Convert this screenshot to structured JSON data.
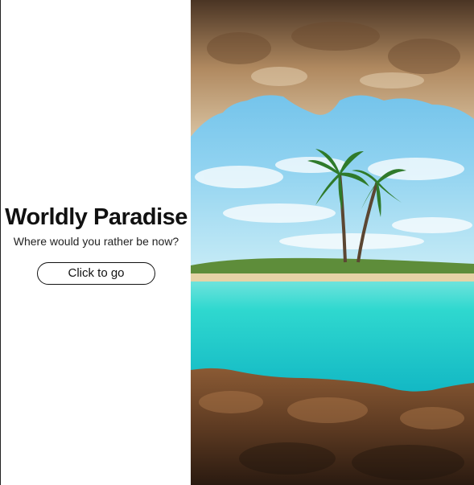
{
  "hero": {
    "title": "Worldly Paradise",
    "subtitle": "Where would you rather be now?",
    "cta_label": "Click to go"
  },
  "image": {
    "subject": "tropical island with two palm trees seen through a rocky cave opening",
    "colors": {
      "sky": "#7cc8ec",
      "sea": "#2fd8cf",
      "rock": "#9a6a43",
      "palm": "#2f7a2a"
    }
  }
}
